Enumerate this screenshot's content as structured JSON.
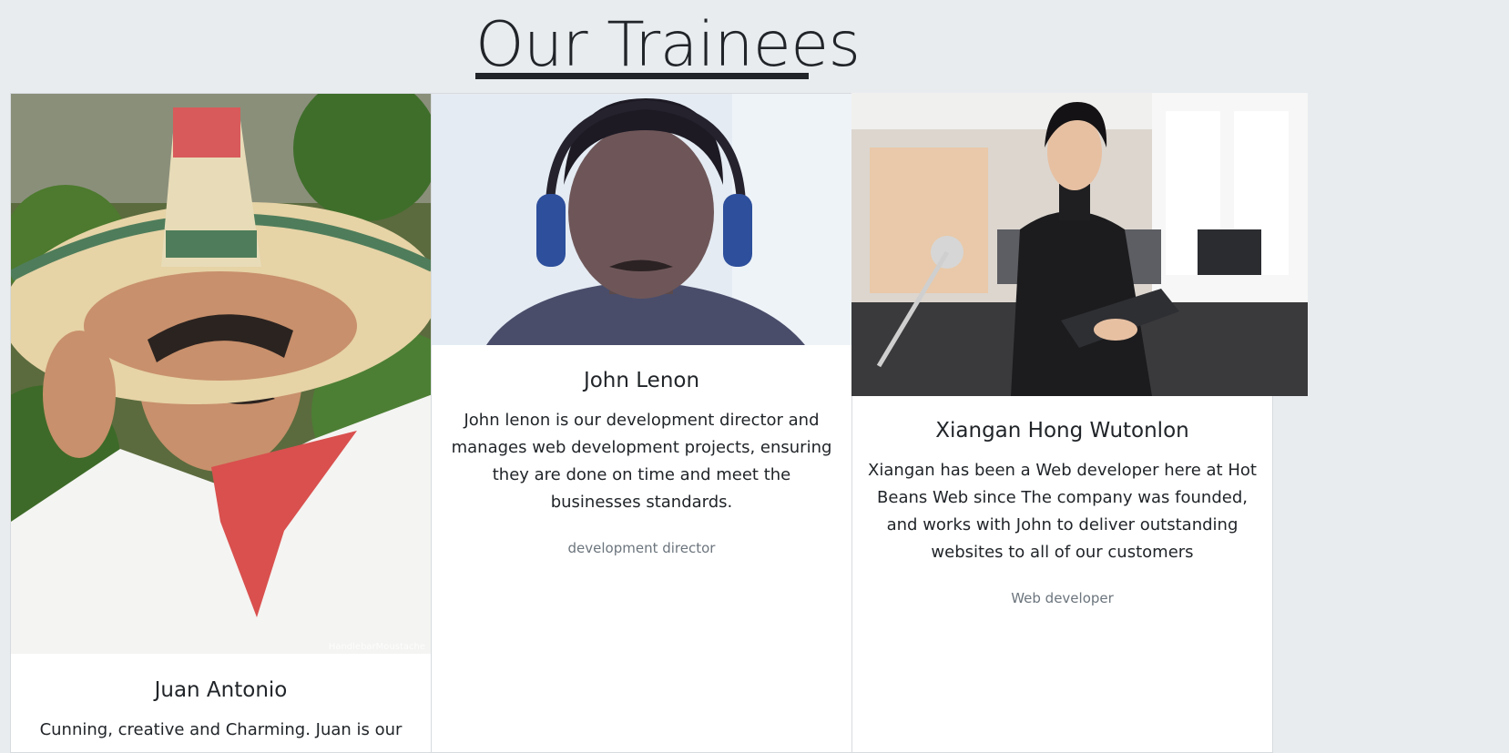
{
  "page": {
    "title": "Our Trainees"
  },
  "trainees": [
    {
      "name": "Juan Antonio",
      "description": "Cunning, creative and Charming. Juan is our",
      "role": "",
      "photo_watermark": "HandlebarMoustache"
    },
    {
      "name": "John Lenon",
      "description": "John lenon is our development director and manages web development projects, ensuring they are done on time and meet the businesses standards.",
      "role": "development director"
    },
    {
      "name": "Xiangan Hong Wutonlon",
      "description": "Xiangan has been a Web developer here at Hot Beans Web since The company was founded, and works with John to deliver outstanding websites to all of our customers",
      "role": "Web developer"
    }
  ],
  "colors": {
    "background": "#e9ecef",
    "card": "#ffffff",
    "muted": "#6c757d",
    "text": "#212529"
  }
}
